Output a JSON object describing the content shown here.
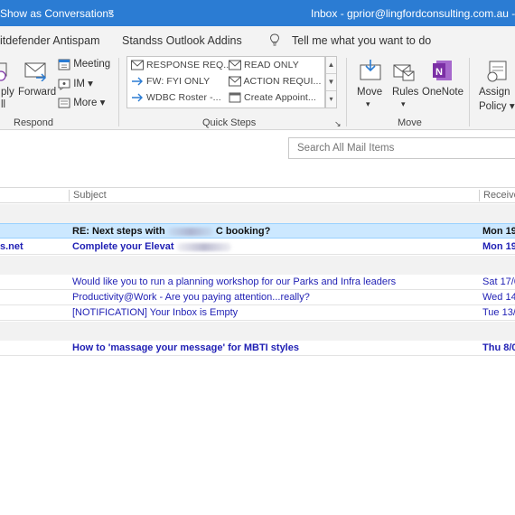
{
  "titlebar": {
    "show_conversations": "Show as Conversations",
    "qa_caret": "▿",
    "window_title": "Inbox - gprior@lingfordconsulting.com.au  -  O"
  },
  "tabs": [
    {
      "label": "itdefender Antispam"
    },
    {
      "label": "Standss Outlook Addins"
    },
    {
      "label": "Tell me what you want to do"
    }
  ],
  "ribbon": {
    "respond": {
      "reply_all": [
        "ply",
        "ll"
      ],
      "forward": "Forward",
      "meeting": "Meeting",
      "im": "IM ▾",
      "more": "More ▾",
      "label": "Respond"
    },
    "quick_steps": {
      "items": [
        "RESPONSE REQ...",
        "READ ONLY",
        "FW: FYI ONLY",
        "ACTION REQUI...",
        "WDBC Roster -...",
        "Create Appoint..."
      ],
      "label": "Quick Steps"
    },
    "move": {
      "move": "Move",
      "rules": "Rules",
      "onenote": "OneNote",
      "label": "Move",
      "caret": "▾"
    },
    "tags": {
      "assign_policy": [
        "Assign",
        "Policy ▾"
      ]
    }
  },
  "search": {
    "placeholder": "Search All Mail Items"
  },
  "columns": {
    "subject": "Subject",
    "received": "Receive"
  },
  "messages": [
    {
      "from": "",
      "subject_a": "RE: Next steps with",
      "subject_b": "C booking?",
      "received": "Mon 19"
    },
    {
      "from": "s.net",
      "subject_a": "Complete your Elevat",
      "subject_b": "",
      "received": "Mon 19"
    },
    {
      "from": "",
      "subject": "Would like you to run a planning workshop for our Parks and Infra leaders",
      "received": "Sat 17/0"
    },
    {
      "from": "",
      "subject": "Productivity@Work - Are you paying attention...really?",
      "received": "Wed 14,"
    },
    {
      "from": "",
      "subject": "[NOTIFICATION] Your Inbox is Empty",
      "received": "Tue 13/0"
    },
    {
      "from": "",
      "subject": "How to 'massage your message' for MBTI styles",
      "received": "Thu 8/0"
    }
  ],
  "colors": {
    "titlebar": "#2b7cd3",
    "unread_link": "#1f1fb4",
    "selected_row": "#cce8ff",
    "onenote": "#7b2fa5"
  }
}
